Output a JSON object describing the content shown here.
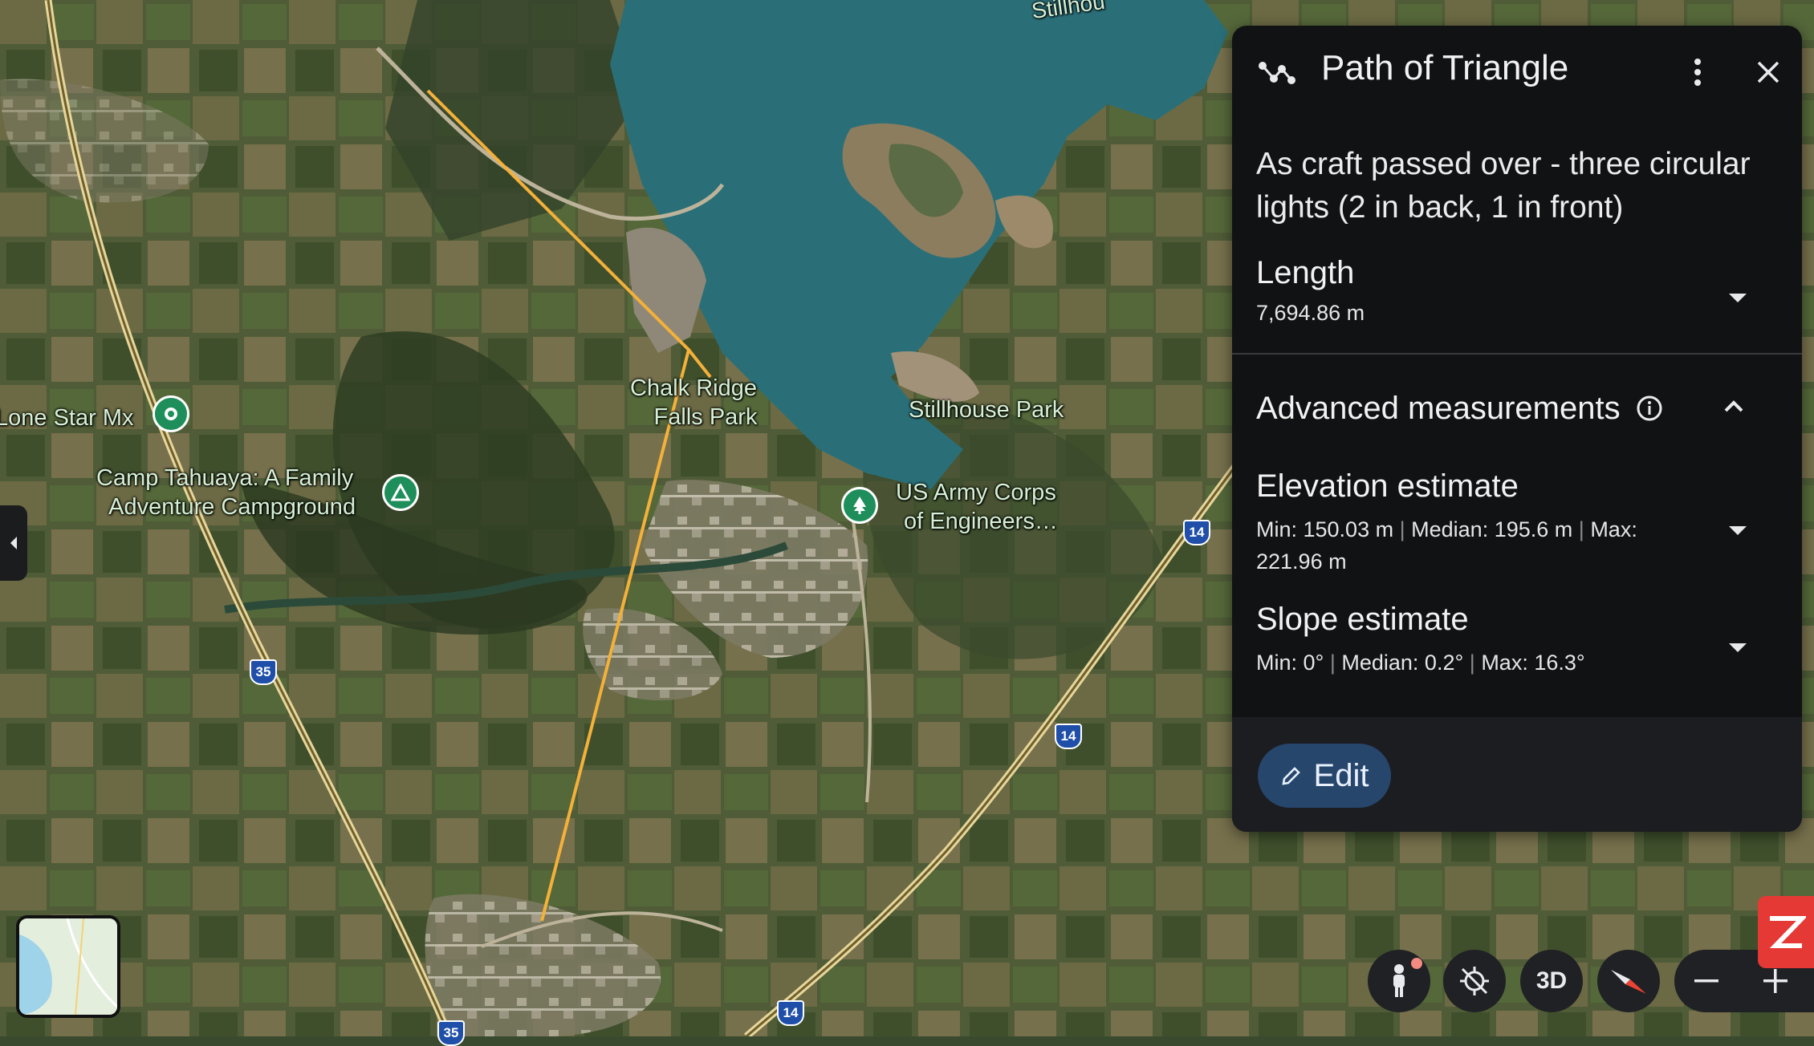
{
  "map": {
    "labels": {
      "lone_star": "Lone Star Mx",
      "camp_line1": "Camp Tahuaya: A Family",
      "camp_line2": "Adventure Campground",
      "chalk_line1": "Chalk Ridge",
      "chalk_line2": "Falls Park",
      "stillhouse_park": "Stillhouse Park",
      "army_line1": "US Army Corps",
      "army_line2": "of Engineers…",
      "stillhouse_top": "Stillhou"
    },
    "shields": {
      "i35_a": "35",
      "i35_b": "35",
      "i14_a": "14",
      "i14_b": "14",
      "i14_c": "14"
    },
    "colors": {
      "path": "#f4b13a",
      "poi_green": "#1e8e5a",
      "water": "#2a6f78"
    }
  },
  "panel": {
    "title": "Path of Triangle",
    "description": "As craft passed over - three circular lights (2 in back, 1 in front)",
    "length_title": "Length",
    "length_value": "7,694.86 m",
    "advanced_title": "Advanced measurements",
    "elevation_title": "Elevation estimate",
    "elevation_line1": "Min: 150.03 m",
    "elevation_line1b": "Median: 195.6 m",
    "elevation_line1c": "Max:",
    "elevation_line2": "221.96 m",
    "slope_title": "Slope estimate",
    "slope_min": "Min: 0°",
    "slope_median": "Median: 0.2°",
    "slope_max": "Max: 16.3°",
    "separator": "|",
    "edit_label": "Edit",
    "icons": {
      "path": "path-icon",
      "more": "more-vert-icon",
      "close": "close-icon",
      "info": "info-icon",
      "edit": "pencil-icon"
    }
  },
  "controls": {
    "three_d_label": "3D"
  }
}
